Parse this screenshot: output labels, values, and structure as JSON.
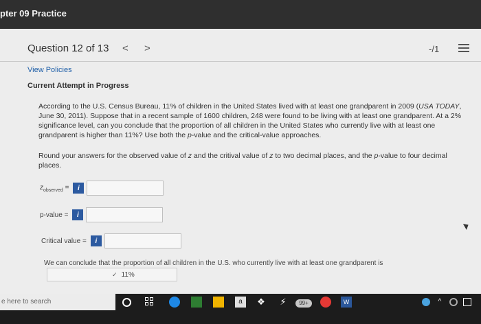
{
  "window": {
    "title": "pter 09 Practice"
  },
  "question_header": {
    "title": "Question 12 of 13",
    "prev": "<",
    "next": ">",
    "score": "-/1"
  },
  "links": {
    "view_policies": "View Policies"
  },
  "status": {
    "attempt": "Current Attempt in Progress"
  },
  "question": {
    "p1": "According to the U.S. Census Bureau, 11% of children in the United States lived with at least one grandparent in 2009 (",
    "source": "USA TODAY",
    "p2": ", June 30, 2011). Suppose that in a recent sample of 1600 children, 248 were found to be living with at least one grandparent. At a 2% significance level, can you conclude that the proportion of all children in the United States who currently live with at least one grandparent is higher than 11%? Use both the ",
    "pvalue_term": "p",
    "p3": "-value and the critical-value approaches."
  },
  "instructions": {
    "t1": "Round your answers for the observed value of ",
    "z1": "z",
    "t2": " and the critival value of ",
    "z2": "z",
    "t3": " to two decimal places, and the ",
    "p": "p",
    "t4": "-value to four decimal places."
  },
  "fields": {
    "z_label": "z",
    "z_sub": "observed",
    "z_eq": " =",
    "pvalue_label": "p-value =",
    "critical_label": "Critical value =",
    "info": "i"
  },
  "conclusion": {
    "text": "We can conclude that the proportion of all children in the U.S. who currently live with at least one grandparent is",
    "selected": "11%"
  },
  "taskbar": {
    "search": "e here to search",
    "a_label": "a",
    "badge": "99+",
    "word": "W",
    "dropbox": "❖",
    "bolt": "⚡"
  }
}
